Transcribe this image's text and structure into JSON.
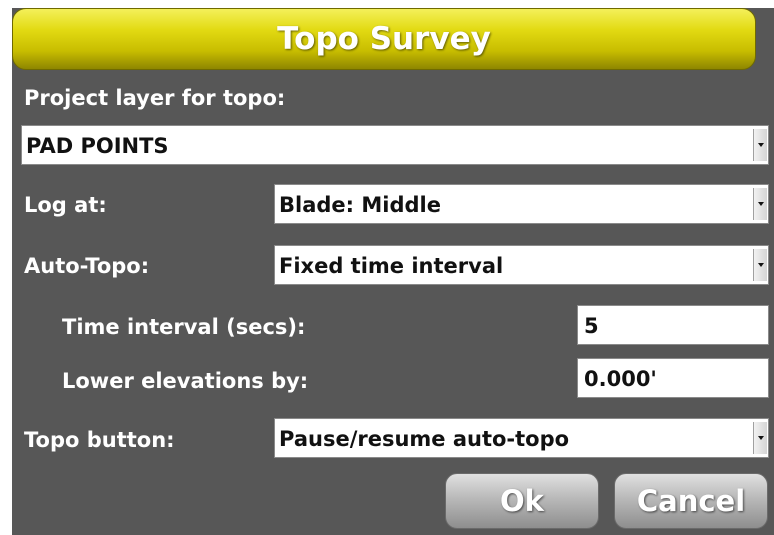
{
  "dialog": {
    "title": "Topo Survey"
  },
  "project_layer": {
    "label": "Project layer for topo:",
    "selected": "PAD POINTS"
  },
  "log_at": {
    "label": "Log at:",
    "selected": "Blade: Middle"
  },
  "auto_topo": {
    "label": "Auto-Topo:",
    "selected": "Fixed time interval"
  },
  "time_interval": {
    "label": "Time interval (secs):",
    "value": "5"
  },
  "lower_elevations": {
    "label": "Lower elevations by:",
    "value": "0.000'"
  },
  "topo_button": {
    "label": "Topo button:",
    "selected": "Pause/resume auto-topo"
  },
  "buttons": {
    "ok": "Ok",
    "cancel": "Cancel"
  },
  "icons": {
    "dropdown": "chevron-down-icon"
  },
  "colors": {
    "title_bar": "#d8cf10",
    "dialog_bg": "#575757",
    "button": "#b0b0b0"
  }
}
